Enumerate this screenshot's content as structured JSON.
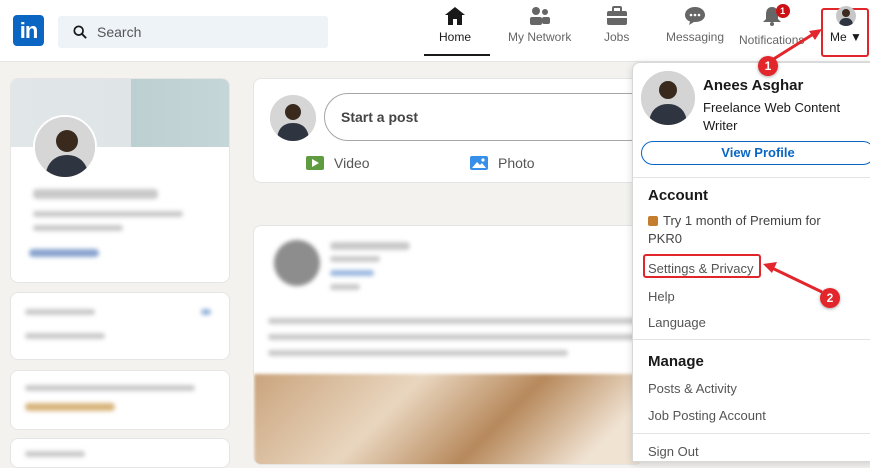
{
  "topbar": {
    "logo_text": "in",
    "search_placeholder": "Search",
    "nav": {
      "home": "Home",
      "network": "My Network",
      "jobs": "Jobs",
      "messaging": "Messaging",
      "notifications": "Notifications",
      "me": "Me"
    },
    "notifications_badge": "1"
  },
  "composer": {
    "start_post": "Start a post",
    "video": "Video",
    "photo": "Photo"
  },
  "dropdown": {
    "name": "Anees Asghar",
    "headline": "Freelance Web Content Writer",
    "view_profile": "View Profile",
    "account_title": "Account",
    "premium": "Try 1 month of Premium for PKR0",
    "settings": "Settings & Privacy",
    "help": "Help",
    "language": "Language",
    "manage_title": "Manage",
    "posts_activity": "Posts & Activity",
    "job_posting": "Job Posting Account",
    "sign_out": "Sign Out"
  },
  "annotations": {
    "step1": "1",
    "step2": "2",
    "color": "#e2262c"
  },
  "colors": {
    "brand": "#0a66c2",
    "badge": "#cc1016",
    "highlight": "#e0252b"
  }
}
